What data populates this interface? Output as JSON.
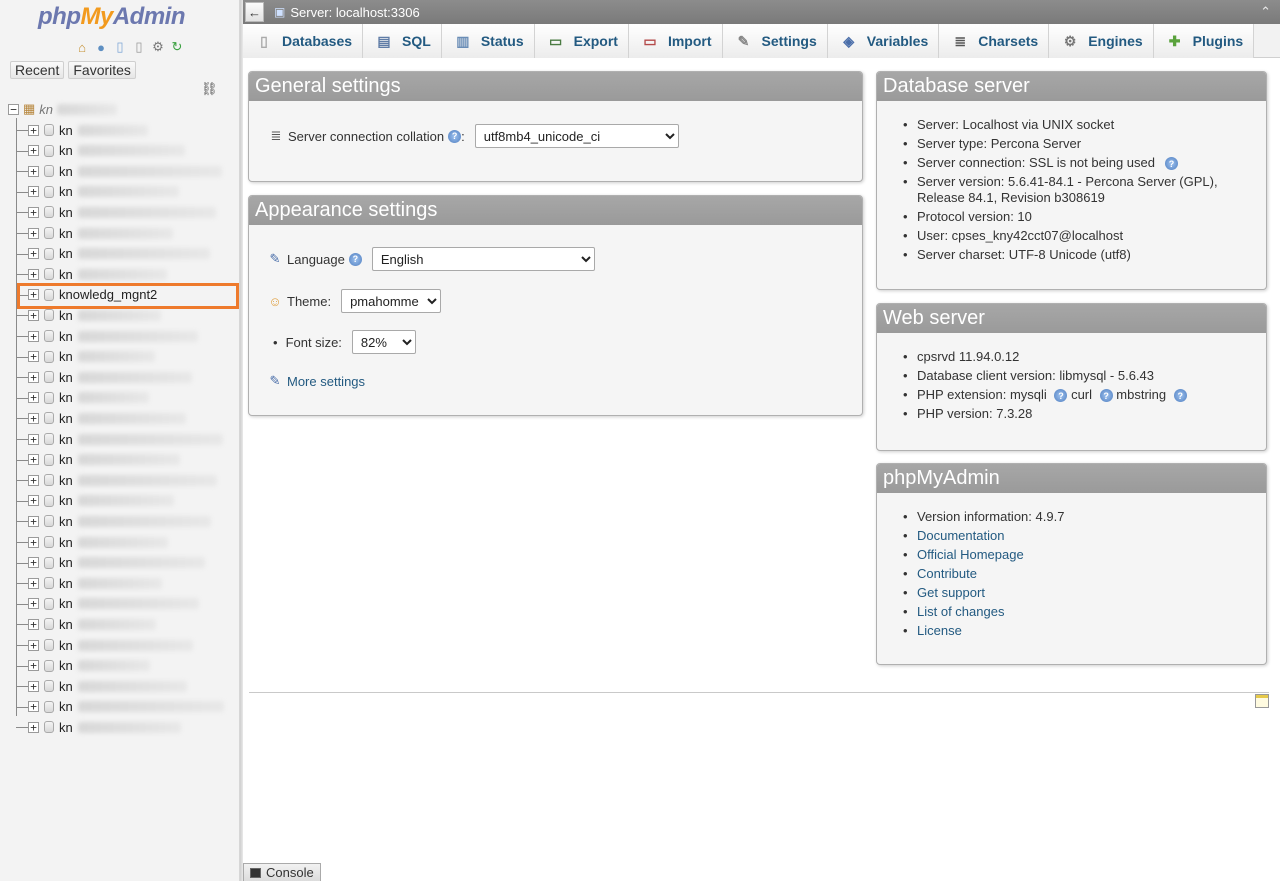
{
  "brand": {
    "part1": "php",
    "part2": "My",
    "part3": "Admin"
  },
  "nav": {
    "recent_label": "Recent",
    "favorites_label": "Favorites",
    "root_prefix": "kn",
    "databases": [
      "kn",
      "kn",
      "kn",
      "kn",
      "kn",
      "kn",
      "kn",
      "kn",
      "knowledg_mgnt2",
      "kn",
      "kn",
      "kn",
      "kn",
      "kn",
      "kn",
      "kn",
      "kn",
      "kn",
      "kn",
      "kn",
      "kn",
      "kn",
      "kn",
      "kn",
      "kn",
      "kn",
      "kn",
      "kn",
      "kn",
      "kn"
    ],
    "highlighted_db": "knowledg_mgnt2"
  },
  "topbar": {
    "server_label": "Server: localhost:3306"
  },
  "tabs": [
    {
      "label": "Databases",
      "icon": "database-icon"
    },
    {
      "label": "SQL",
      "icon": "sql-icon"
    },
    {
      "label": "Status",
      "icon": "status-icon"
    },
    {
      "label": "Export",
      "icon": "export-icon"
    },
    {
      "label": "Import",
      "icon": "import-icon"
    },
    {
      "label": "Settings",
      "icon": "wrench-icon"
    },
    {
      "label": "Variables",
      "icon": "variables-icon"
    },
    {
      "label": "Charsets",
      "icon": "charsets-icon"
    },
    {
      "label": "Engines",
      "icon": "engines-icon"
    },
    {
      "label": "Plugins",
      "icon": "plugins-icon"
    }
  ],
  "general": {
    "title": "General settings",
    "collation_label": "Server connection collation",
    "collation_value": "utf8mb4_unicode_ci"
  },
  "appearance": {
    "title": "Appearance settings",
    "language_label": "Language",
    "language_value": "English",
    "theme_label": "Theme:",
    "theme_value": "pmahomme",
    "fontsize_label": "Font size:",
    "fontsize_value": "82%",
    "more_settings": "More settings"
  },
  "db_server": {
    "title": "Database server",
    "items": [
      "Server: Localhost via UNIX socket",
      "Server type: Percona Server",
      "Server connection: SSL is not being used",
      "Server version: 5.6.41-84.1 - Percona Server (GPL), Release 84.1, Revision b308619",
      "Protocol version: 10",
      "User: cpses_kny42cct07@localhost",
      "Server charset: UTF-8 Unicode (utf8)"
    ]
  },
  "web_server": {
    "title": "Web server",
    "item1": "cpsrvd 11.94.0.12",
    "item2": "Database client version: libmysql - 5.6.43",
    "item3_prefix": "PHP extension: mysqli",
    "item3_curl": "curl",
    "item3_mbstring": "mbstring",
    "item4": "PHP version: 7.3.28"
  },
  "pma": {
    "title": "phpMyAdmin",
    "version": "Version information: 4.9.7",
    "links": [
      "Documentation",
      "Official Homepage",
      "Contribute",
      "Get support",
      "List of changes",
      "License"
    ]
  },
  "console": {
    "label": "Console"
  },
  "colors": {
    "accent": "#235a81",
    "highlight": "#ee7a2c",
    "header_gray": "#9a9a9a"
  }
}
